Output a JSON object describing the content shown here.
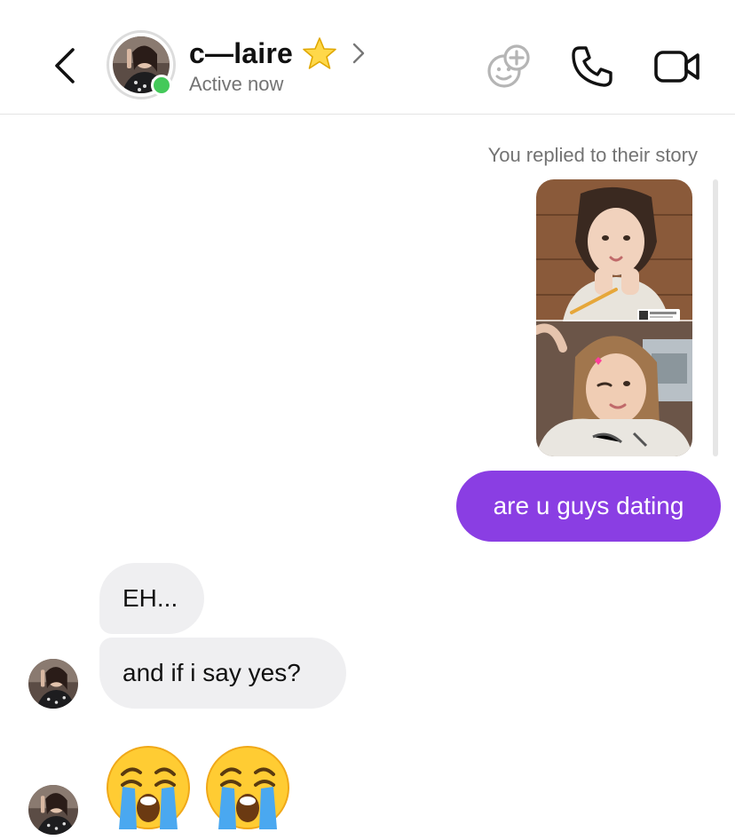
{
  "header": {
    "name": "c—laire",
    "status": "Active now",
    "icons": {
      "back": "chevron-left-icon",
      "star": "star-icon",
      "profile": "chevron-right-icon",
      "add_sticker": "add-face-icon",
      "call": "phone-icon",
      "video": "video-camera-icon"
    },
    "online_color": "#44c95a"
  },
  "thread": {
    "story_caption": "You replied to their story",
    "outgoing": [
      {
        "text": "are u guys dating"
      }
    ],
    "incoming": [
      {
        "text": "EH..."
      },
      {
        "text": "and if i say yes?"
      }
    ],
    "emoji_reply": [
      "crying-face-emoji",
      "crying-face-emoji"
    ],
    "accent_color": "#8a3ee3"
  }
}
